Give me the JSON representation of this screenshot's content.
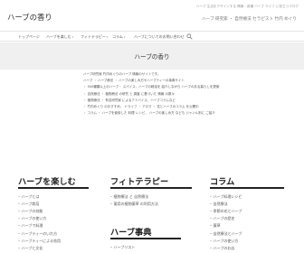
{
  "header": {
    "topline": "ハーブ 生活をデザインする 情報・各種 ハーブ ライフ に役立つブログ",
    "site_title": "ハーブの香り",
    "site_subtitle": "ハーブ 研究家 ・ 自然療法 セラピスト 竹内 めぐり"
  },
  "nav": {
    "items": [
      {
        "label": "トップページ"
      },
      {
        "label": "ハーブを楽しむ",
        "caret": "▾"
      },
      {
        "label": "フィトテラピー",
        "caret": "▾"
      },
      {
        "label": "コラム",
        "caret": "▾"
      },
      {
        "label": "ハーブについてのお問い合わせ"
      }
    ],
    "search_icon": "search-icon"
  },
  "hero": {
    "title": "ハーブの香り"
  },
  "intro": [
    "ハーブ研究家 竹内めぐりのハーブ 情報のサイトです。",
    "ハーブ ・ ハーブ療法 ・ ハーブの楽しみ方やハーブティーの事典サイト",
    "・ 500種類以上のハーブ・ スパイス、ハーブの精油を 紹介しながら ハーブのある暮らしを提案",
    "・ 自然療法 ・ 植物療法 の研究 と 調査 に基づいた 情報 の数々",
    "・ 植物療法 ・ 有名研究家 によるアドバイス、ハーブコラムなど",
    "・ 竹内めぐり のおすすめ、 ドライフ ・ アロマ ・ 花とハーブのコラム を公開中",
    "・ コラム ・ ハーブを使用した 料理 レシピ、 ハーブの楽しみ方 なども ジャンル別に ご紹介"
  ],
  "columns": {
    "enjoy": {
      "title": "ハーブを楽しむ",
      "items": [
        "ハーブとは",
        "ハーブ栽培",
        "ハーブの効能",
        "ハーブの使い方",
        "ハーブで料理",
        "ハーブティーのいれ方",
        "ハーブティーによる効用",
        "ハーブと文化"
      ]
    },
    "phyto": {
      "title": "フィトテラピー",
      "items": [
        "植物療法 と 自然療法",
        "薬用の植物薬草 の利用方法"
      ]
    },
    "column": {
      "title": "コラム",
      "items": [
        "ハーブ料理レシピ",
        "自然療法",
        "季節の花とハーブ",
        "ハーブの歴史",
        "薬草",
        "自然療法とハーブ",
        "ハーブの使い方",
        "ハーブのお店"
      ]
    },
    "dictionary": {
      "title": "ハーブ事典",
      "items": [
        "ハーブリスト"
      ]
    }
  }
}
